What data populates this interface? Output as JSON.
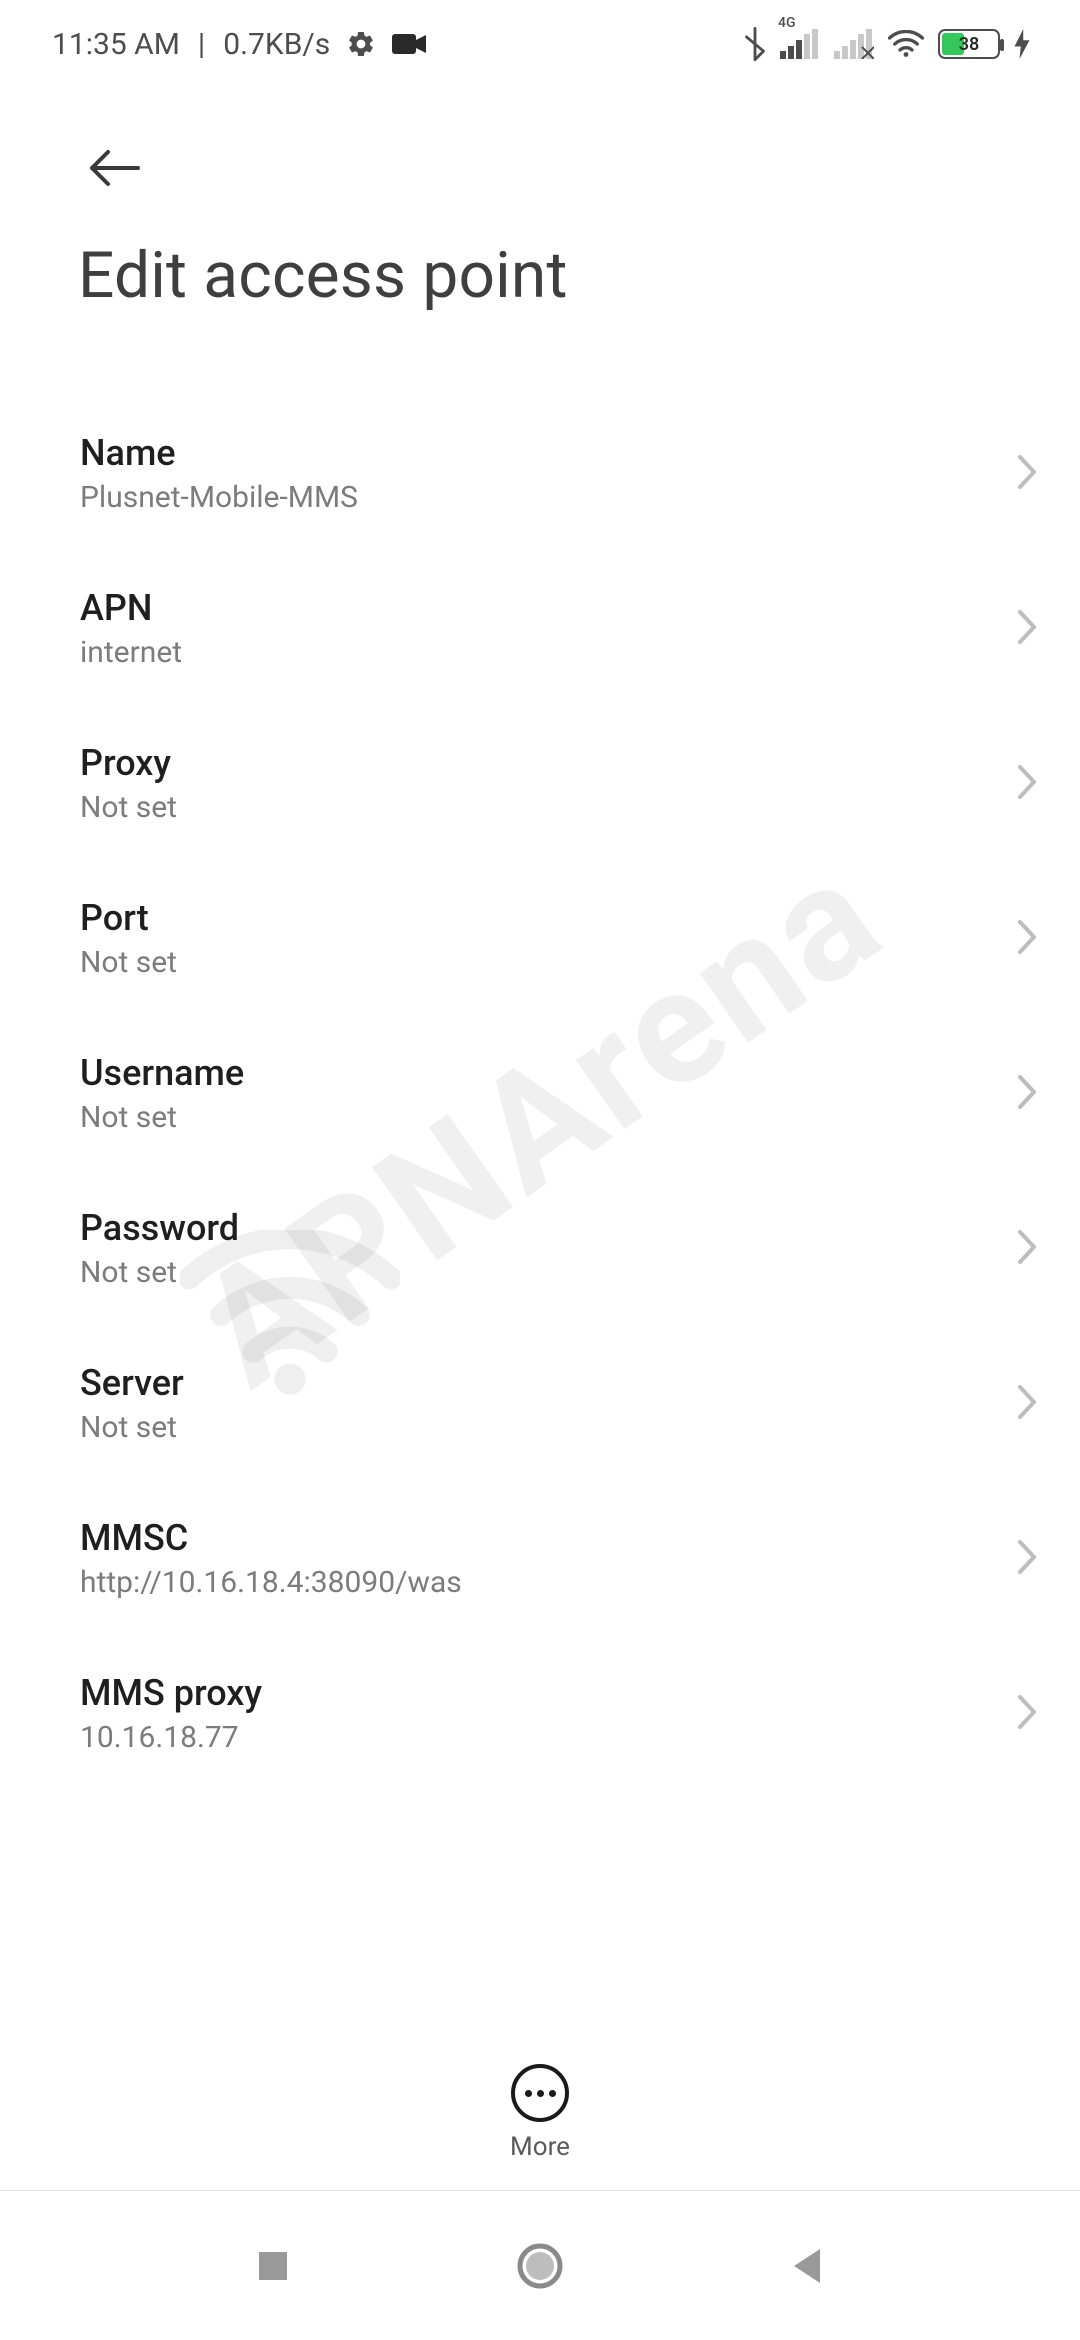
{
  "status": {
    "time": "11:35 AM",
    "net_rate": "0.7KB/s",
    "network_label": "4G",
    "battery_pct": "38"
  },
  "page": {
    "title": "Edit access point"
  },
  "rows": [
    {
      "label": "Name",
      "value": "Plusnet-Mobile-MMS"
    },
    {
      "label": "APN",
      "value": "internet"
    },
    {
      "label": "Proxy",
      "value": "Not set"
    },
    {
      "label": "Port",
      "value": "Not set"
    },
    {
      "label": "Username",
      "value": "Not set"
    },
    {
      "label": "Password",
      "value": "Not set"
    },
    {
      "label": "Server",
      "value": "Not set"
    },
    {
      "label": "MMSC",
      "value": "http://10.16.18.4:38090/was"
    },
    {
      "label": "MMS proxy",
      "value": "10.16.18.77"
    }
  ],
  "more_label": "More",
  "watermark": "APNArena"
}
